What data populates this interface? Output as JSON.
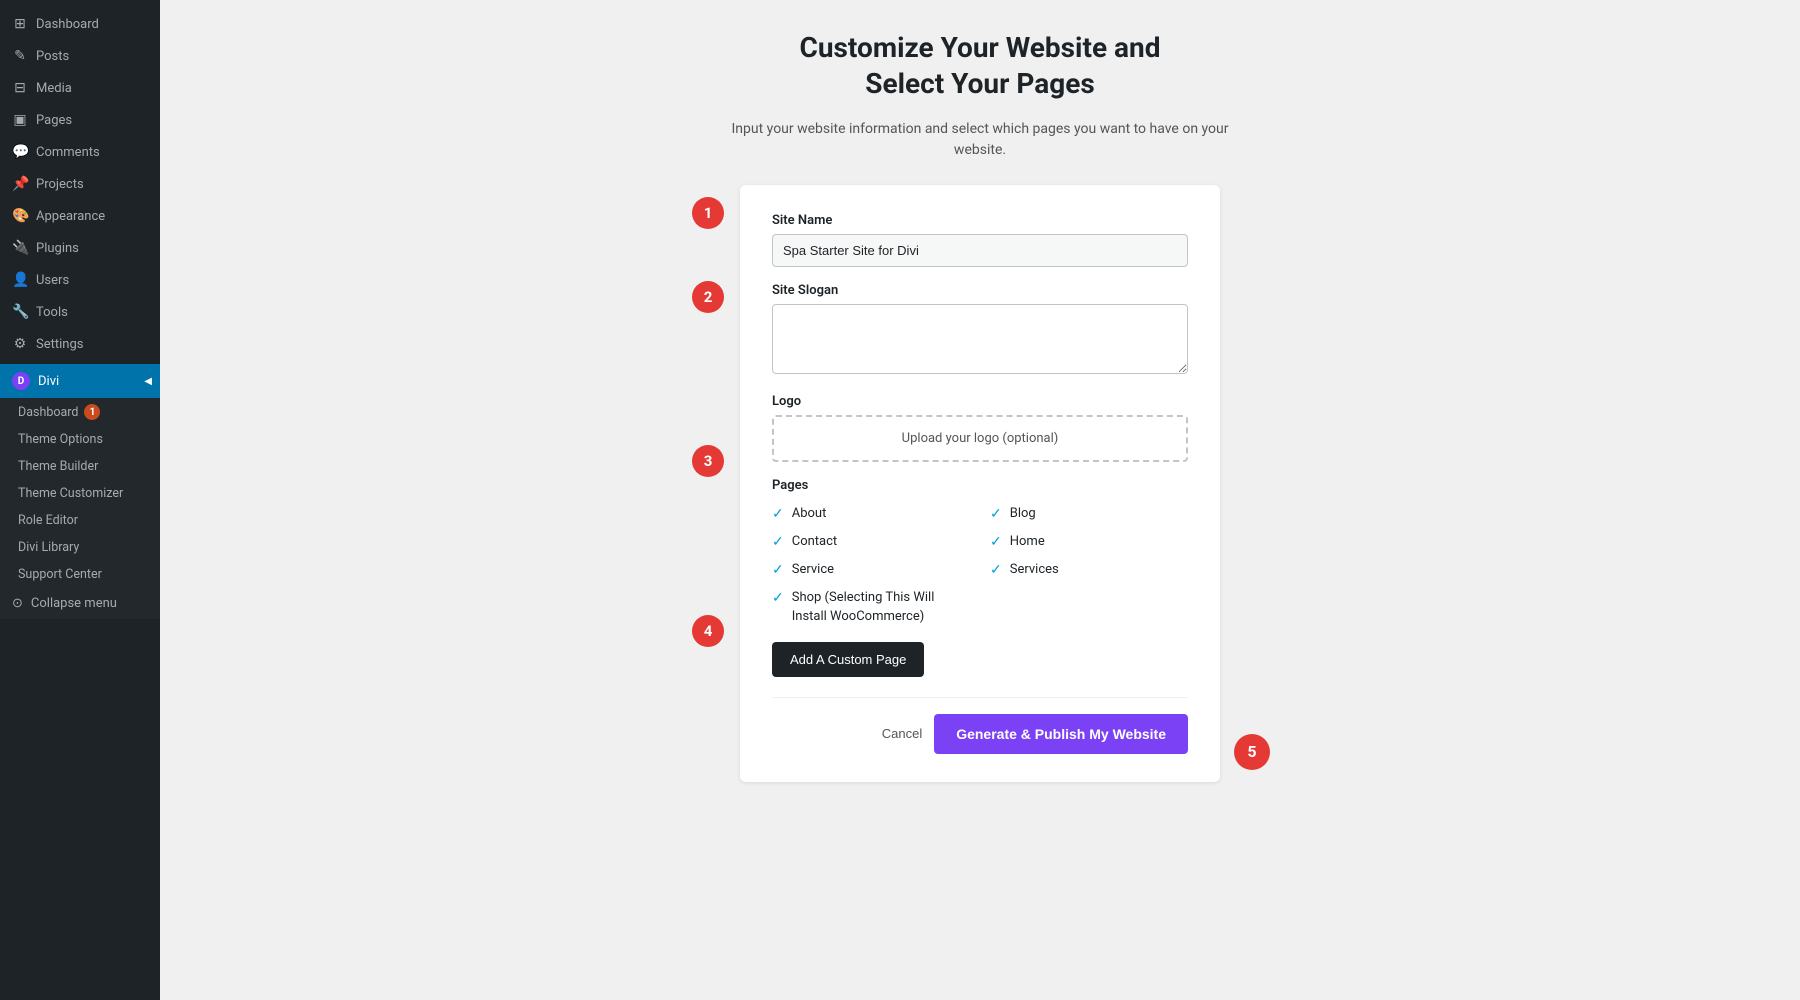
{
  "sidebar": {
    "items": [
      {
        "id": "dashboard",
        "label": "Dashboard",
        "icon": "⊞"
      },
      {
        "id": "posts",
        "label": "Posts",
        "icon": "✎"
      },
      {
        "id": "media",
        "label": "Media",
        "icon": "⊟"
      },
      {
        "id": "pages",
        "label": "Pages",
        "icon": "▣"
      },
      {
        "id": "comments",
        "label": "Comments",
        "icon": "💬"
      },
      {
        "id": "projects",
        "label": "Projects",
        "icon": "📌"
      },
      {
        "id": "appearance",
        "label": "Appearance",
        "icon": "🎨"
      },
      {
        "id": "plugins",
        "label": "Plugins",
        "icon": "🔌"
      },
      {
        "id": "users",
        "label": "Users",
        "icon": "👤"
      },
      {
        "id": "tools",
        "label": "Tools",
        "icon": "🔧"
      },
      {
        "id": "settings",
        "label": "Settings",
        "icon": "⚙"
      }
    ],
    "divi": {
      "label": "Divi",
      "sub_items": [
        {
          "id": "dashboard",
          "label": "Dashboard",
          "badge": 1
        },
        {
          "id": "theme-options",
          "label": "Theme Options"
        },
        {
          "id": "theme-builder",
          "label": "Theme Builder"
        },
        {
          "id": "theme-customizer",
          "label": "Theme Customizer"
        },
        {
          "id": "role-editor",
          "label": "Role Editor"
        },
        {
          "id": "divi-library",
          "label": "Divi Library"
        },
        {
          "id": "support-center",
          "label": "Support Center"
        }
      ],
      "collapse": "Collapse menu"
    }
  },
  "main": {
    "title_line1": "Customize Your Website and",
    "title_line2": "Select Your Pages",
    "subtitle": "Input your website information and select which pages you want to have on your website.",
    "form": {
      "site_name_label": "Site Name",
      "site_name_value": "Spa Starter Site for Divi",
      "site_slogan_label": "Site Slogan",
      "site_slogan_placeholder": "",
      "logo_label": "Logo",
      "logo_upload_text": "Upload your logo (optional)",
      "pages_label": "Pages",
      "pages": [
        {
          "id": "about",
          "label": "About",
          "checked": true,
          "col": 1
        },
        {
          "id": "blog",
          "label": "Blog",
          "checked": true,
          "col": 2
        },
        {
          "id": "contact",
          "label": "Contact",
          "checked": true,
          "col": 1
        },
        {
          "id": "home",
          "label": "Home",
          "checked": true,
          "col": 2
        },
        {
          "id": "service",
          "label": "Service",
          "checked": true,
          "col": 1
        },
        {
          "id": "services",
          "label": "Services",
          "checked": true,
          "col": 2
        },
        {
          "id": "shop",
          "label": "Shop (Selecting This Will Install WooCommerce)",
          "checked": true,
          "col": 1
        }
      ],
      "add_custom_page_label": "Add A Custom Page",
      "cancel_label": "Cancel",
      "publish_label": "Generate & Publish My Website"
    },
    "steps": [
      "1",
      "2",
      "3",
      "4",
      "5"
    ]
  }
}
